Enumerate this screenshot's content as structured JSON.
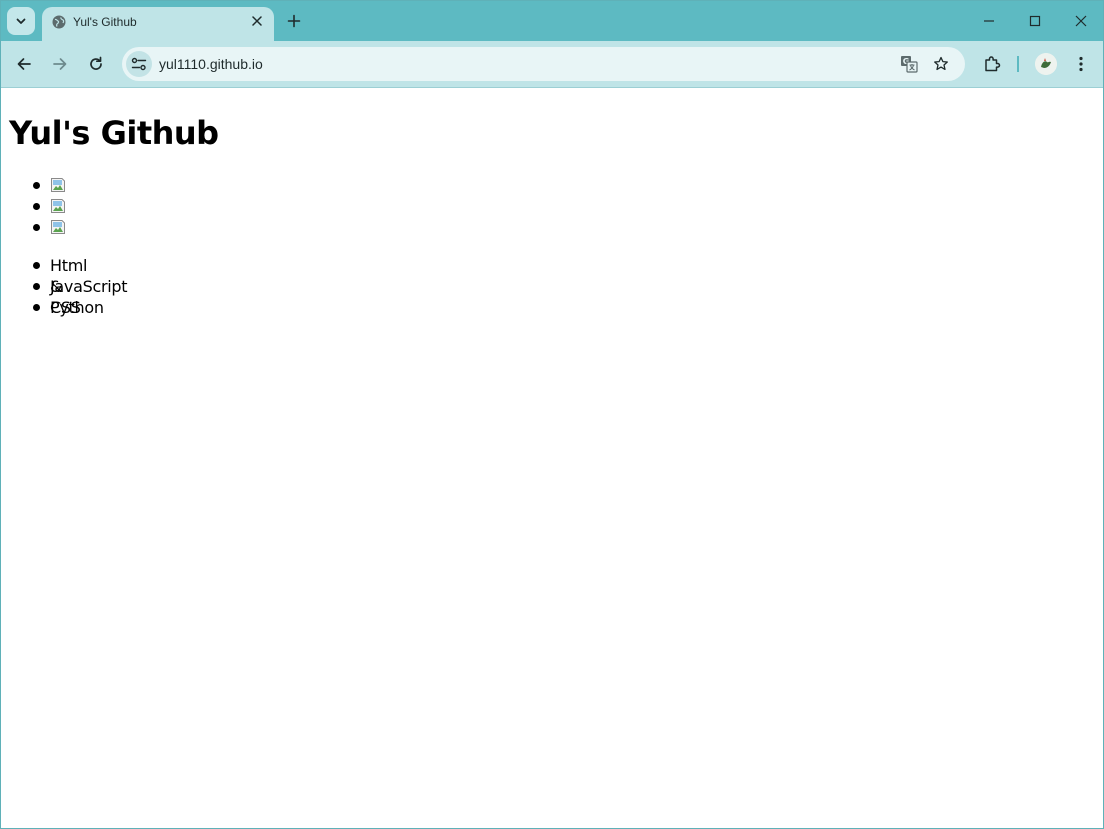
{
  "browser": {
    "tab": {
      "title": "Yul's Github",
      "favicon": "globe-icon"
    },
    "address_bar": {
      "url": "yul1110.github.io"
    },
    "colors": {
      "tab_strip": "#5dbac2",
      "toolbar": "#bfe4e7",
      "omnibox": "#e8f5f6"
    }
  },
  "page": {
    "heading": "Yul's Github",
    "image_list": [
      {
        "icon": "broken-image-icon"
      },
      {
        "icon": "broken-image-icon"
      },
      {
        "icon": "broken-image-icon"
      }
    ],
    "text_list": [
      {
        "label": "Html & CSS"
      },
      {
        "label": "JavaScript"
      },
      {
        "label": "Python"
      }
    ]
  }
}
